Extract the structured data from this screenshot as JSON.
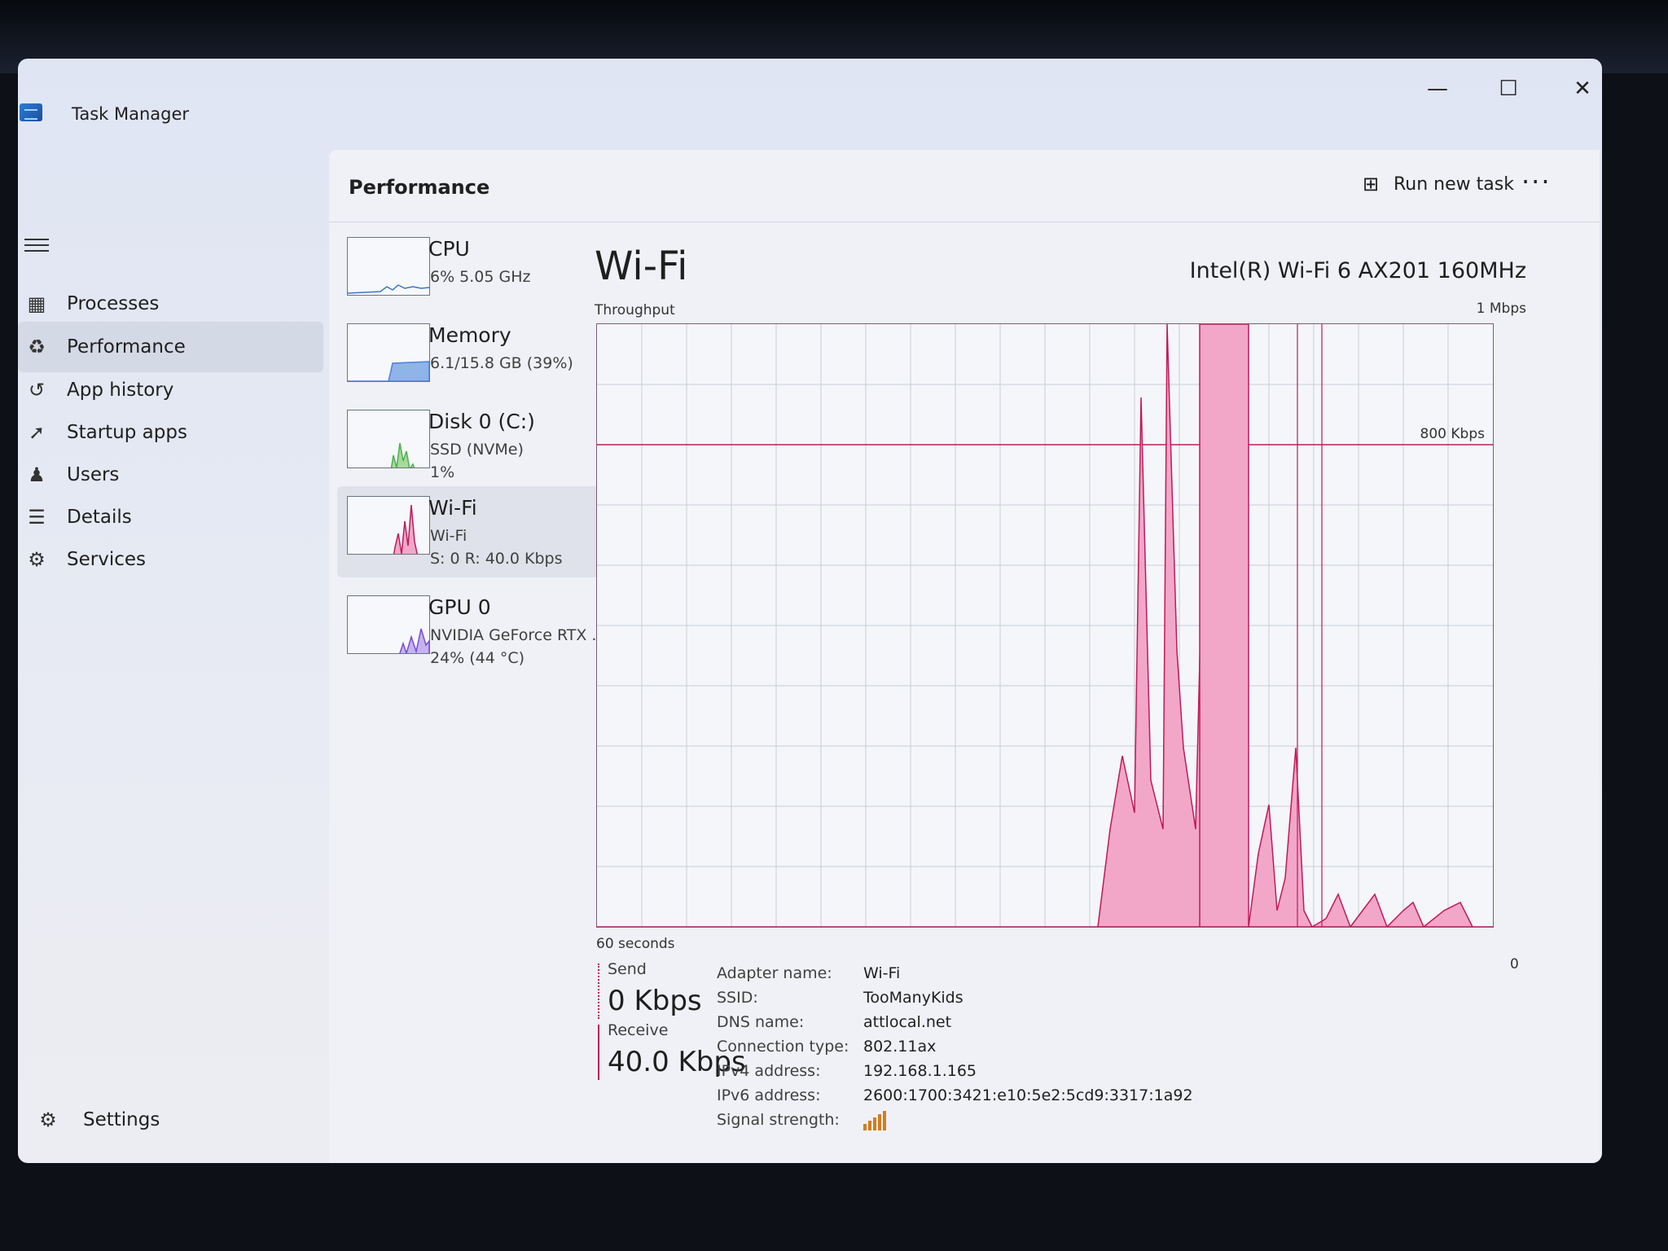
{
  "app": {
    "title": "Task Manager"
  },
  "nav": {
    "items": [
      {
        "label": "Processes",
        "icon": "processes-icon"
      },
      {
        "label": "Performance",
        "icon": "performance-icon",
        "active": true
      },
      {
        "label": "App history",
        "icon": "history-icon"
      },
      {
        "label": "Startup apps",
        "icon": "startup-icon"
      },
      {
        "label": "Users",
        "icon": "users-icon"
      },
      {
        "label": "Details",
        "icon": "details-icon"
      },
      {
        "label": "Services",
        "icon": "services-icon"
      }
    ],
    "settings_label": "Settings"
  },
  "header": {
    "title": "Performance",
    "run_task_label": "Run new task",
    "more_label": "···"
  },
  "tiles": [
    {
      "name": "CPU",
      "lines": [
        "6% 5.05 GHz"
      ],
      "color": "#3a78c2"
    },
    {
      "name": "Memory",
      "lines": [
        "6.1/15.8 GB (39%)"
      ],
      "color": "#4a83d6"
    },
    {
      "name": "Disk 0 (C:)",
      "lines": [
        "SSD (NVMe)",
        "1%"
      ],
      "color": "#4caf50"
    },
    {
      "name": "Wi-Fi",
      "lines": [
        "Wi-Fi",
        "S: 0 R: 40.0 Kbps"
      ],
      "color": "#c2185b",
      "active": true
    },
    {
      "name": "GPU 0",
      "lines": [
        "NVIDIA GeForce RTX ...",
        "24% (44 °C)"
      ],
      "color": "#7b4bd6"
    }
  ],
  "detail": {
    "title": "Wi-Fi",
    "adapter": "Intel(R) Wi-Fi 6 AX201 160MHz",
    "throughput_label": "Throughput",
    "max_label": "1 Mbps",
    "ref_label": "800 Kbps",
    "x_left": "60 seconds",
    "x_right": "0",
    "send": {
      "label": "Send",
      "value": "0 Kbps",
      "color": "#c2185b"
    },
    "receive": {
      "label": "Receive",
      "value": "40.0 Kbps",
      "color": "#c2185b"
    },
    "props": [
      {
        "key": "Adapter name:",
        "value": "Wi-Fi"
      },
      {
        "key": "SSID:",
        "value": "TooManyKids"
      },
      {
        "key": "DNS name:",
        "value": "attlocal.net"
      },
      {
        "key": "Connection type:",
        "value": "802.11ax"
      },
      {
        "key": "IPv4 address:",
        "value": "192.168.1.165"
      },
      {
        "key": "IPv6 address:",
        "value": "2600:1700:3421:e10:5e2:5cd9:3317:1a92"
      },
      {
        "key": "Signal strength:",
        "value": "",
        "bars": 5
      }
    ]
  },
  "colors": {
    "accent": "#1f5fc4",
    "graph_fill": "#f2a7c8",
    "graph_line": "#c2185b"
  }
}
